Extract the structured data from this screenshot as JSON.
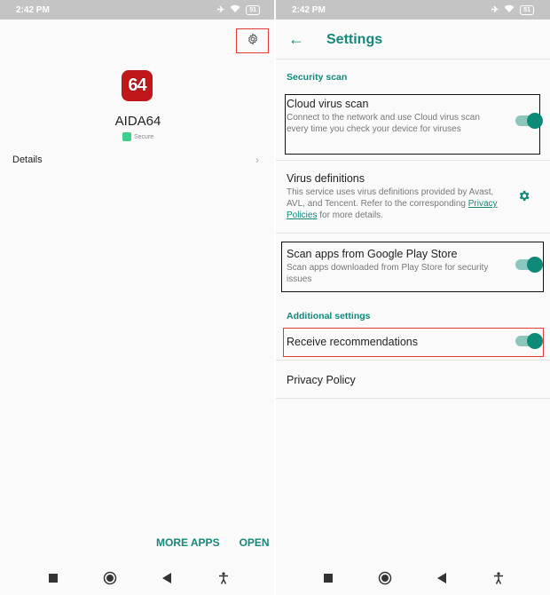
{
  "left": {
    "status": {
      "time": "2:42 PM",
      "battery": "51"
    },
    "app": {
      "icon_text": "64",
      "name": "AIDA64",
      "secure_label": "Secure"
    },
    "details_label": "Details",
    "actions": {
      "more_apps": "MORE APPS",
      "open": "OPEN"
    }
  },
  "right": {
    "status": {
      "time": "2:42 PM",
      "battery": "51"
    },
    "title": "Settings",
    "sections": {
      "security_scan": "Security scan",
      "additional": "Additional settings"
    },
    "items": {
      "cloud": {
        "title": "Cloud virus scan",
        "sub": "Connect to the network and use Cloud virus scan every time you check your device for viruses"
      },
      "defs": {
        "title": "Virus definitions",
        "sub_pre": "This service uses virus definitions provided by Avast, AVL, and Tencent. Refer to the corresponding ",
        "link": "Privacy Policies",
        "sub_post": " for more details."
      },
      "playstore": {
        "title": "Scan apps from Google Play Store",
        "sub": "Scan apps downloaded from Play Store for security issues"
      },
      "recommend": {
        "title": "Receive recommendations"
      },
      "privacy": {
        "title": "Privacy Policy"
      }
    }
  },
  "colors": {
    "accent": "#12897a",
    "highlight_red": "#e53935",
    "app_icon": "#c0171b"
  }
}
